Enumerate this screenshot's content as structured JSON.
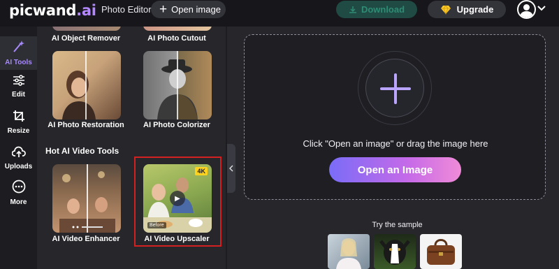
{
  "header": {
    "logo_main": "picwand",
    "logo_dot": ".ai",
    "app_name": "Photo Editor",
    "open_image_label": "Open image",
    "download_label": "Download",
    "upgrade_label": "Upgrade"
  },
  "rail": {
    "items": [
      {
        "label": "AI Tools",
        "icon": "sparkle-icon"
      },
      {
        "label": "Edit",
        "icon": "sliders-icon"
      },
      {
        "label": "Resize",
        "icon": "crop-icon"
      },
      {
        "label": "Uploads",
        "icon": "cloud-upload-icon"
      },
      {
        "label": "More",
        "icon": "more-dots-icon"
      }
    ]
  },
  "panel": {
    "tools_top": [
      "AI Object Remover",
      "AI Photo Cutout"
    ],
    "tools_photo": [
      "AI Photo Restoration",
      "AI Photo Colorizer"
    ],
    "section_title": "Hot AI Video Tools",
    "tools_video": [
      "AI Video Enhancer",
      "AI Video Upscaler"
    ],
    "badge_4k": "4K",
    "before_label": "Before"
  },
  "main": {
    "drop_text": "Click \"Open an image\" or drag the image here",
    "open_button_label": "Open an Image",
    "try_sample_label": "Try the sample"
  },
  "colors": {
    "accent": "#a78bfa",
    "highlight_border": "#d32020",
    "download_bg": "#204b44"
  }
}
